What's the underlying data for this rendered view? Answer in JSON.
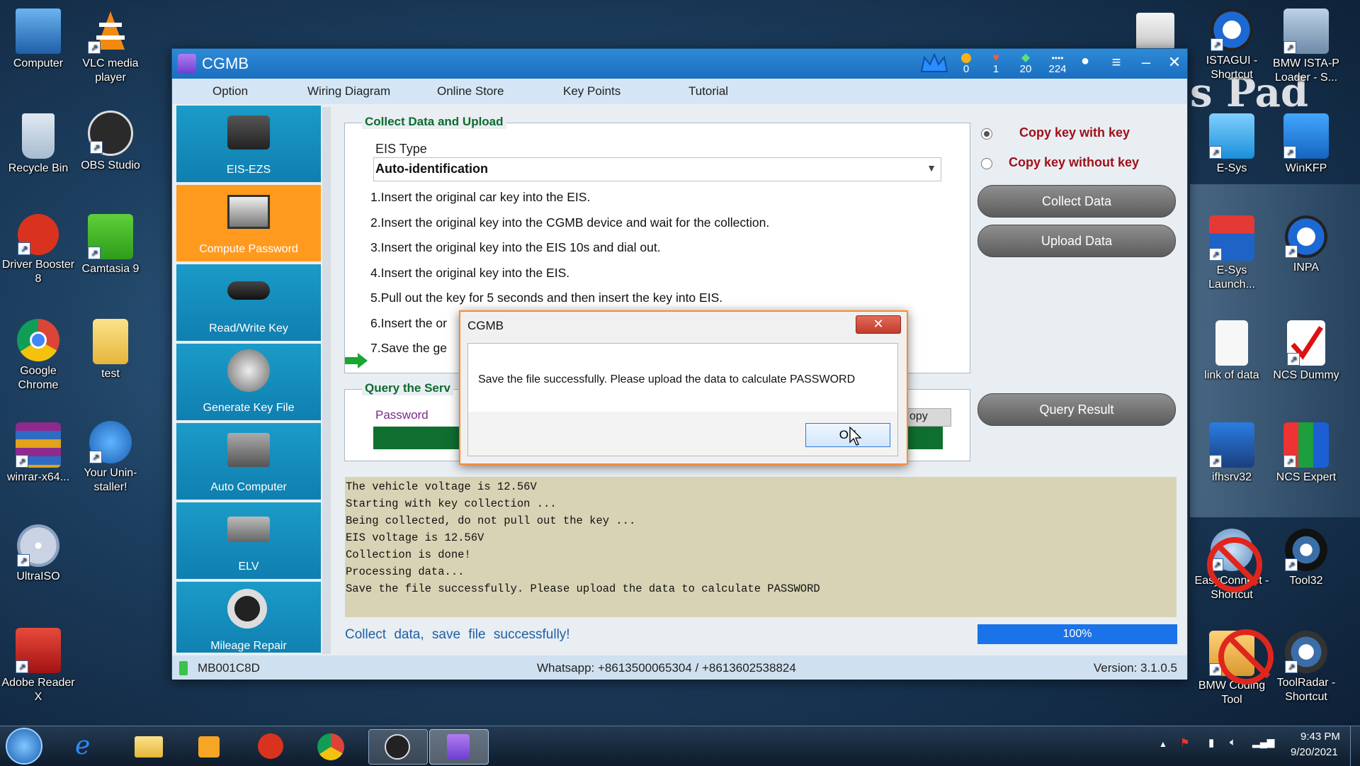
{
  "desktop": {
    "icons_left": [
      {
        "label": "Computer",
        "icon": "computer-icon"
      },
      {
        "label": "VLC media player",
        "icon": "vlc-icon"
      },
      {
        "label": "Recycle Bin",
        "icon": "recycle-bin-icon"
      },
      {
        "label": "OBS Studio",
        "icon": "obs-icon"
      },
      {
        "label": "Driver Booster 8",
        "icon": "driver-booster-icon"
      },
      {
        "label": "Camtasia 9",
        "icon": "camtasia-icon"
      },
      {
        "label": "Google Chrome",
        "icon": "chrome-icon"
      },
      {
        "label": "test",
        "icon": "folder-icon"
      },
      {
        "label": "winrar-x64...",
        "icon": "winrar-icon"
      },
      {
        "label": "Your Unin-staller!",
        "icon": "uninstaller-icon"
      },
      {
        "label": "UltraISO",
        "icon": "ultraiso-icon"
      },
      {
        "label": "Adobe Reader X",
        "icon": "adobe-reader-icon"
      }
    ],
    "icons_right": [
      {
        "label": "ISTAGUI - Shortcut",
        "icon": "istagui-icon"
      },
      {
        "label": "BMW ISTA-P Loader - S...",
        "icon": "ista-p-icon"
      },
      {
        "label": "E-Sys",
        "icon": "esys-icon"
      },
      {
        "label": "WinKFP",
        "icon": "winkfp-icon"
      },
      {
        "label": "E-Sys Launch...",
        "icon": "esys-launcher-icon"
      },
      {
        "label": "INPA",
        "icon": "inpa-icon"
      },
      {
        "label": "link of data",
        "icon": "document-icon"
      },
      {
        "label": "NCS Dummy",
        "icon": "ncs-dummy-icon"
      },
      {
        "label": "ifhsrv32",
        "icon": "ifhsrv-icon"
      },
      {
        "label": "NCS Expert",
        "icon": "ncs-expert-icon"
      },
      {
        "label": "EasyConnect - Shortcut",
        "icon": "easyconnect-icon"
      },
      {
        "label": "Tool32",
        "icon": "tool32-icon"
      },
      {
        "label": "BMW Coding Tool",
        "icon": "bmw-coding-icon"
      },
      {
        "label": "ToolRadar - Shortcut",
        "icon": "toolradar-icon"
      }
    ],
    "decor_text": "s Pad"
  },
  "app": {
    "title": "CGMB",
    "stats": [
      {
        "value": "0",
        "icon": "coin-icon"
      },
      {
        "value": "1",
        "icon": "heart-icon"
      },
      {
        "value": "20",
        "icon": "diamond-icon"
      },
      {
        "value": "224",
        "icon": "dots-icon"
      }
    ],
    "menu": [
      "Option",
      "Wiring Diagram",
      "Online Store",
      "Key Points",
      "Tutorial"
    ],
    "sidebar": [
      {
        "label": "EIS-EZS",
        "active": false
      },
      {
        "label": "Compute Password",
        "active": true
      },
      {
        "label": "Read/Write Key",
        "active": false
      },
      {
        "label": "Generate Key File",
        "active": false
      },
      {
        "label": "Auto Computer",
        "active": false
      },
      {
        "label": "ELV",
        "active": false
      },
      {
        "label": "Mileage Repair",
        "active": false
      }
    ],
    "collect": {
      "title": "Collect Data and Upload",
      "eis_type_label": "EIS Type",
      "eis_type_value": "Auto-identification",
      "steps": [
        "1.Insert the original car key into the EIS.",
        "2.Insert the original key into the CGMB device and wait for the collection.",
        "3.Insert the original key into the EIS 10s and dial out.",
        "4.Insert the original key into the EIS.",
        "5.Pull out the key for 5 seconds and then insert the key into EIS.",
        "6.Insert the or",
        "7.Save the ge"
      ]
    },
    "options": {
      "copy_with_key": "Copy key with key",
      "copy_without_key": "Copy key without key",
      "selected": "with"
    },
    "buttons": {
      "collect": "Collect Data",
      "upload": "Upload Data",
      "query_result": "Query Result"
    },
    "query": {
      "title": "Query the Serv",
      "password_label": "Password",
      "copy_label": "opy"
    },
    "log": [
      "The vehicle voltage is 12.56V",
      "Starting with key collection ...",
      "Being collected, do not pull out the key ...",
      "EIS voltage is 12.56V",
      "Collection is done!",
      "Processing data...",
      "Save the file successfully. Please upload the data to calculate PASSWORD"
    ],
    "status_message": "Collect data, save file successfully!",
    "progress": {
      "value": 1.0,
      "label": "100%"
    },
    "statusbar": {
      "device": "MB001C8D",
      "contact": "Whatsapp: +8613500065304 / +8613602538824",
      "version": "Version: 3.1.0.5"
    }
  },
  "dialog": {
    "title": "CGMB",
    "message": "Save the file successfully. Please upload the data to calculate PASSWORD",
    "ok": "OK",
    "close": "✕"
  },
  "taskbar": {
    "time": "9:43 PM",
    "date": "9/20/2021"
  }
}
